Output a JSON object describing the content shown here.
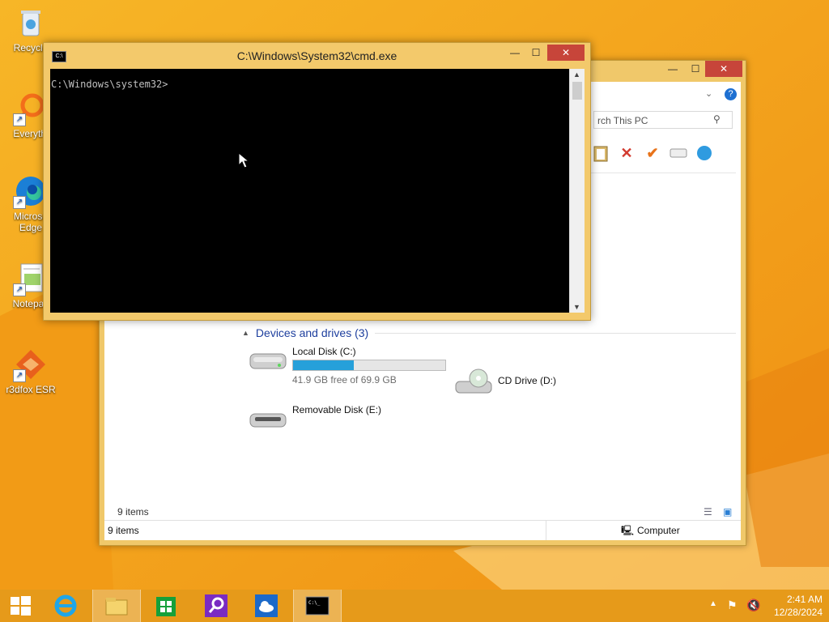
{
  "colors": {
    "desktop": "#f3a21a",
    "accent": "#26a0da",
    "taskbar": "#e69a1a"
  },
  "desktop": {
    "icons": [
      {
        "label": "Recycle",
        "icon": "recycle-bin-icon"
      },
      {
        "label": "Everythi",
        "icon": "everything-search-icon"
      },
      {
        "label": "Microso Edge",
        "icon": "edge-icon"
      },
      {
        "label": "Notepac",
        "icon": "notepad-icon"
      },
      {
        "label": "r3dfox ESR",
        "icon": "r3dfox-icon"
      }
    ]
  },
  "cmd": {
    "title": "C:\\Windows\\System32\\cmd.exe",
    "prompt": "C:\\Windows\\system32>"
  },
  "explorer": {
    "search_placeholder": "rch This PC",
    "section_title": "Devices and drives (3)",
    "drives": [
      {
        "name": "Local Disk (C:)",
        "free_text": "41.9 GB free of 69.9 GB",
        "used_fraction": 0.4
      },
      {
        "name": "CD Drive (D:)"
      },
      {
        "name": "Removable Disk (E:)"
      }
    ],
    "items_count": "9 items",
    "status_items": "9 items",
    "status_location": "Computer"
  },
  "taskbar": {
    "time": "2:41 AM",
    "date": "12/28/2024"
  }
}
